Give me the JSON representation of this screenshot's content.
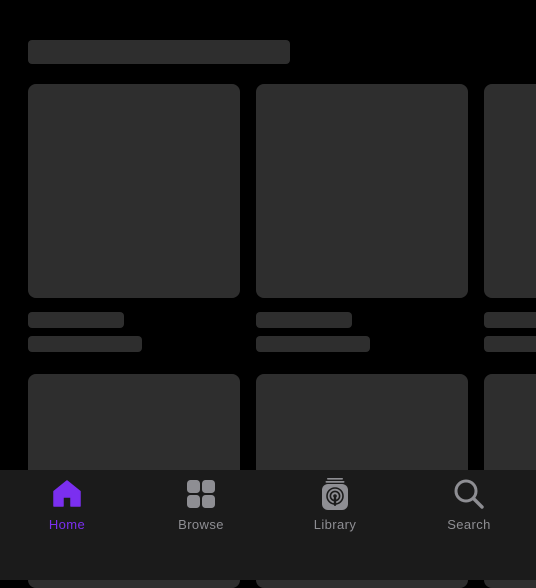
{
  "colors": {
    "background": "#000000",
    "skeleton": "#2e2e2e",
    "tab_bar": "#1b1b1b",
    "accent": "#7b2ff0",
    "inactive": "#8e8e93"
  },
  "tabs": [
    {
      "label": "Home",
      "icon": "home-icon",
      "active": true
    },
    {
      "label": "Browse",
      "icon": "grid-icon",
      "active": false
    },
    {
      "label": "Library",
      "icon": "podcast-library-icon",
      "active": false
    },
    {
      "label": "Search",
      "icon": "search-icon",
      "active": false
    }
  ]
}
